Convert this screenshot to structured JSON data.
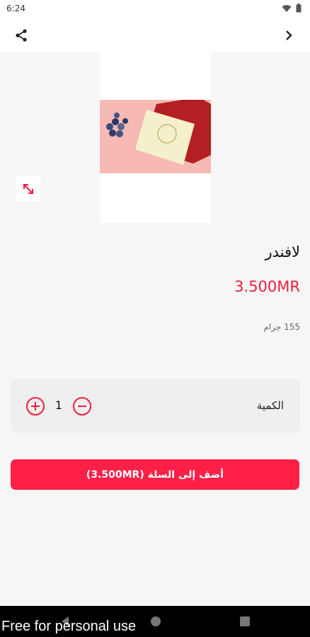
{
  "status_bar": {
    "time": "6:24"
  },
  "product": {
    "title": "لافندر",
    "price": "3.500MR",
    "weight": "155 جرام"
  },
  "quantity": {
    "label": "الكمية",
    "value": "1"
  },
  "add_to_cart": {
    "label": "أضف إلى السلة (3.500MR)"
  },
  "watermark": "Free for personal use",
  "colors": {
    "accent": "#ee1d3f",
    "button": "#ff1f47",
    "background": "#f6f6f6"
  },
  "icons": [
    "share-icon",
    "chevron-right-icon",
    "expand-icon",
    "plus-circle-icon",
    "minus-circle-icon"
  ]
}
